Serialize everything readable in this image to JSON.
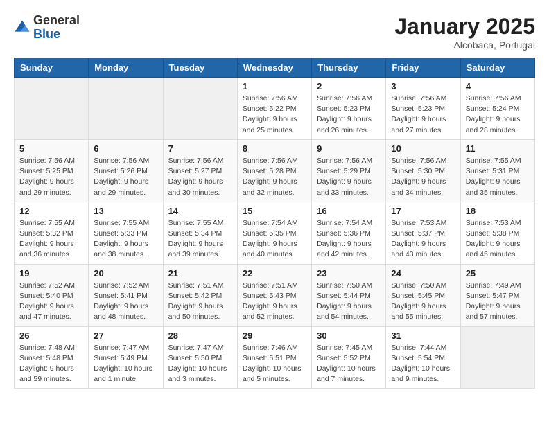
{
  "logo": {
    "general": "General",
    "blue": "Blue"
  },
  "title": "January 2025",
  "location": "Alcobaca, Portugal",
  "weekdays": [
    "Sunday",
    "Monday",
    "Tuesday",
    "Wednesday",
    "Thursday",
    "Friday",
    "Saturday"
  ],
  "weeks": [
    [
      {
        "day": "",
        "sunrise": "",
        "sunset": "",
        "daylight": ""
      },
      {
        "day": "",
        "sunrise": "",
        "sunset": "",
        "daylight": ""
      },
      {
        "day": "",
        "sunrise": "",
        "sunset": "",
        "daylight": ""
      },
      {
        "day": "1",
        "sunrise": "Sunrise: 7:56 AM",
        "sunset": "Sunset: 5:22 PM",
        "daylight": "Daylight: 9 hours and 25 minutes."
      },
      {
        "day": "2",
        "sunrise": "Sunrise: 7:56 AM",
        "sunset": "Sunset: 5:23 PM",
        "daylight": "Daylight: 9 hours and 26 minutes."
      },
      {
        "day": "3",
        "sunrise": "Sunrise: 7:56 AM",
        "sunset": "Sunset: 5:23 PM",
        "daylight": "Daylight: 9 hours and 27 minutes."
      },
      {
        "day": "4",
        "sunrise": "Sunrise: 7:56 AM",
        "sunset": "Sunset: 5:24 PM",
        "daylight": "Daylight: 9 hours and 28 minutes."
      }
    ],
    [
      {
        "day": "5",
        "sunrise": "Sunrise: 7:56 AM",
        "sunset": "Sunset: 5:25 PM",
        "daylight": "Daylight: 9 hours and 29 minutes."
      },
      {
        "day": "6",
        "sunrise": "Sunrise: 7:56 AM",
        "sunset": "Sunset: 5:26 PM",
        "daylight": "Daylight: 9 hours and 29 minutes."
      },
      {
        "day": "7",
        "sunrise": "Sunrise: 7:56 AM",
        "sunset": "Sunset: 5:27 PM",
        "daylight": "Daylight: 9 hours and 30 minutes."
      },
      {
        "day": "8",
        "sunrise": "Sunrise: 7:56 AM",
        "sunset": "Sunset: 5:28 PM",
        "daylight": "Daylight: 9 hours and 32 minutes."
      },
      {
        "day": "9",
        "sunrise": "Sunrise: 7:56 AM",
        "sunset": "Sunset: 5:29 PM",
        "daylight": "Daylight: 9 hours and 33 minutes."
      },
      {
        "day": "10",
        "sunrise": "Sunrise: 7:56 AM",
        "sunset": "Sunset: 5:30 PM",
        "daylight": "Daylight: 9 hours and 34 minutes."
      },
      {
        "day": "11",
        "sunrise": "Sunrise: 7:55 AM",
        "sunset": "Sunset: 5:31 PM",
        "daylight": "Daylight: 9 hours and 35 minutes."
      }
    ],
    [
      {
        "day": "12",
        "sunrise": "Sunrise: 7:55 AM",
        "sunset": "Sunset: 5:32 PM",
        "daylight": "Daylight: 9 hours and 36 minutes."
      },
      {
        "day": "13",
        "sunrise": "Sunrise: 7:55 AM",
        "sunset": "Sunset: 5:33 PM",
        "daylight": "Daylight: 9 hours and 38 minutes."
      },
      {
        "day": "14",
        "sunrise": "Sunrise: 7:55 AM",
        "sunset": "Sunset: 5:34 PM",
        "daylight": "Daylight: 9 hours and 39 minutes."
      },
      {
        "day": "15",
        "sunrise": "Sunrise: 7:54 AM",
        "sunset": "Sunset: 5:35 PM",
        "daylight": "Daylight: 9 hours and 40 minutes."
      },
      {
        "day": "16",
        "sunrise": "Sunrise: 7:54 AM",
        "sunset": "Sunset: 5:36 PM",
        "daylight": "Daylight: 9 hours and 42 minutes."
      },
      {
        "day": "17",
        "sunrise": "Sunrise: 7:53 AM",
        "sunset": "Sunset: 5:37 PM",
        "daylight": "Daylight: 9 hours and 43 minutes."
      },
      {
        "day": "18",
        "sunrise": "Sunrise: 7:53 AM",
        "sunset": "Sunset: 5:38 PM",
        "daylight": "Daylight: 9 hours and 45 minutes."
      }
    ],
    [
      {
        "day": "19",
        "sunrise": "Sunrise: 7:52 AM",
        "sunset": "Sunset: 5:40 PM",
        "daylight": "Daylight: 9 hours and 47 minutes."
      },
      {
        "day": "20",
        "sunrise": "Sunrise: 7:52 AM",
        "sunset": "Sunset: 5:41 PM",
        "daylight": "Daylight: 9 hours and 48 minutes."
      },
      {
        "day": "21",
        "sunrise": "Sunrise: 7:51 AM",
        "sunset": "Sunset: 5:42 PM",
        "daylight": "Daylight: 9 hours and 50 minutes."
      },
      {
        "day": "22",
        "sunrise": "Sunrise: 7:51 AM",
        "sunset": "Sunset: 5:43 PM",
        "daylight": "Daylight: 9 hours and 52 minutes."
      },
      {
        "day": "23",
        "sunrise": "Sunrise: 7:50 AM",
        "sunset": "Sunset: 5:44 PM",
        "daylight": "Daylight: 9 hours and 54 minutes."
      },
      {
        "day": "24",
        "sunrise": "Sunrise: 7:50 AM",
        "sunset": "Sunset: 5:45 PM",
        "daylight": "Daylight: 9 hours and 55 minutes."
      },
      {
        "day": "25",
        "sunrise": "Sunrise: 7:49 AM",
        "sunset": "Sunset: 5:47 PM",
        "daylight": "Daylight: 9 hours and 57 minutes."
      }
    ],
    [
      {
        "day": "26",
        "sunrise": "Sunrise: 7:48 AM",
        "sunset": "Sunset: 5:48 PM",
        "daylight": "Daylight: 9 hours and 59 minutes."
      },
      {
        "day": "27",
        "sunrise": "Sunrise: 7:47 AM",
        "sunset": "Sunset: 5:49 PM",
        "daylight": "Daylight: 10 hours and 1 minute."
      },
      {
        "day": "28",
        "sunrise": "Sunrise: 7:47 AM",
        "sunset": "Sunset: 5:50 PM",
        "daylight": "Daylight: 10 hours and 3 minutes."
      },
      {
        "day": "29",
        "sunrise": "Sunrise: 7:46 AM",
        "sunset": "Sunset: 5:51 PM",
        "daylight": "Daylight: 10 hours and 5 minutes."
      },
      {
        "day": "30",
        "sunrise": "Sunrise: 7:45 AM",
        "sunset": "Sunset: 5:52 PM",
        "daylight": "Daylight: 10 hours and 7 minutes."
      },
      {
        "day": "31",
        "sunrise": "Sunrise: 7:44 AM",
        "sunset": "Sunset: 5:54 PM",
        "daylight": "Daylight: 10 hours and 9 minutes."
      },
      {
        "day": "",
        "sunrise": "",
        "sunset": "",
        "daylight": ""
      }
    ]
  ]
}
